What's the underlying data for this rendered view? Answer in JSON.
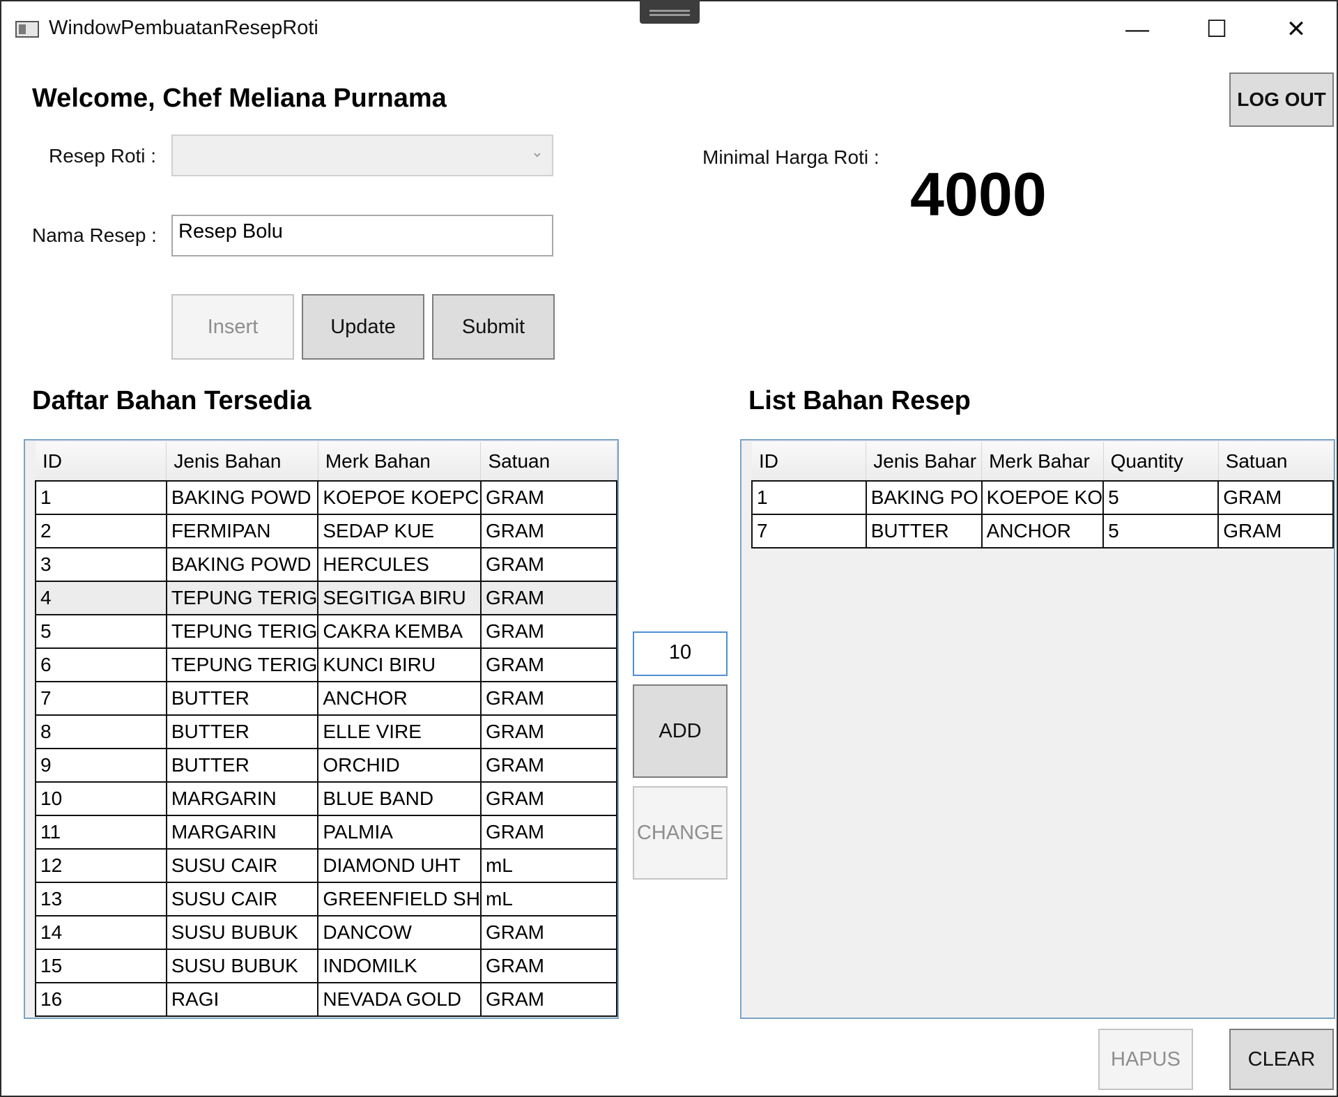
{
  "window": {
    "title": "WindowPembuatanResepRoti",
    "controls": {
      "minimize": "—",
      "maximize": "☐",
      "close": "✕"
    }
  },
  "header": {
    "welcome": "Welcome, Chef Meliana Purnama",
    "logout_label": "LOG OUT"
  },
  "form": {
    "resep_label": "Resep Roti :",
    "resep_selected": "",
    "nama_label": "Nama Resep :",
    "nama_value": "Resep Bolu",
    "insert_label": "Insert",
    "update_label": "Update",
    "submit_label": "Submit"
  },
  "price": {
    "label": "Minimal Harga Roti :",
    "value": "4000"
  },
  "available": {
    "title": "Daftar Bahan Tersedia",
    "columns": [
      "ID",
      "Jenis Bahan",
      "Merk Bahan",
      "Satuan"
    ],
    "rows": [
      [
        "1",
        "BAKING POWD",
        "KOEPOE KOEPC",
        "GRAM"
      ],
      [
        "2",
        "FERMIPAN",
        "SEDAP KUE",
        "GRAM"
      ],
      [
        "3",
        "BAKING POWD",
        "HERCULES",
        "GRAM"
      ],
      [
        "4",
        "TEPUNG TERIG",
        "SEGITIGA BIRU",
        "GRAM"
      ],
      [
        "5",
        "TEPUNG TERIG",
        "CAKRA KEMBA",
        "GRAM"
      ],
      [
        "6",
        "TEPUNG TERIG",
        "KUNCI BIRU",
        "GRAM"
      ],
      [
        "7",
        "BUTTER",
        "ANCHOR",
        "GRAM"
      ],
      [
        "8",
        "BUTTER",
        "ELLE VIRE",
        "GRAM"
      ],
      [
        "9",
        "BUTTER",
        "ORCHID",
        "GRAM"
      ],
      [
        "10",
        "MARGARIN",
        "BLUE BAND",
        "GRAM"
      ],
      [
        "11",
        "MARGARIN",
        "PALMIA",
        "GRAM"
      ],
      [
        "12",
        "SUSU CAIR",
        "DIAMOND UHT",
        "mL"
      ],
      [
        "13",
        "SUSU CAIR",
        "GREENFIELD SH",
        "mL"
      ],
      [
        "14",
        "SUSU BUBUK",
        "DANCOW",
        "GRAM"
      ],
      [
        "15",
        "SUSU BUBUK",
        "INDOMILK",
        "GRAM"
      ],
      [
        "16",
        "RAGI",
        "NEVADA GOLD",
        "GRAM"
      ]
    ]
  },
  "middle": {
    "quantity_value": "10",
    "add_label": "ADD",
    "change_label": "CHANGE"
  },
  "recipe": {
    "title": "List Bahan Resep",
    "columns": [
      "ID",
      "Jenis Bahar",
      "Merk Bahar",
      "Quantity",
      "Satuan"
    ],
    "rows": [
      [
        "1",
        "BAKING PO",
        "KOEPOE KO",
        "5",
        "GRAM"
      ],
      [
        "7",
        "BUTTER",
        "ANCHOR",
        "5",
        "GRAM"
      ]
    ]
  },
  "footer": {
    "hapus_label": "HAPUS",
    "clear_label": "CLEAR"
  }
}
